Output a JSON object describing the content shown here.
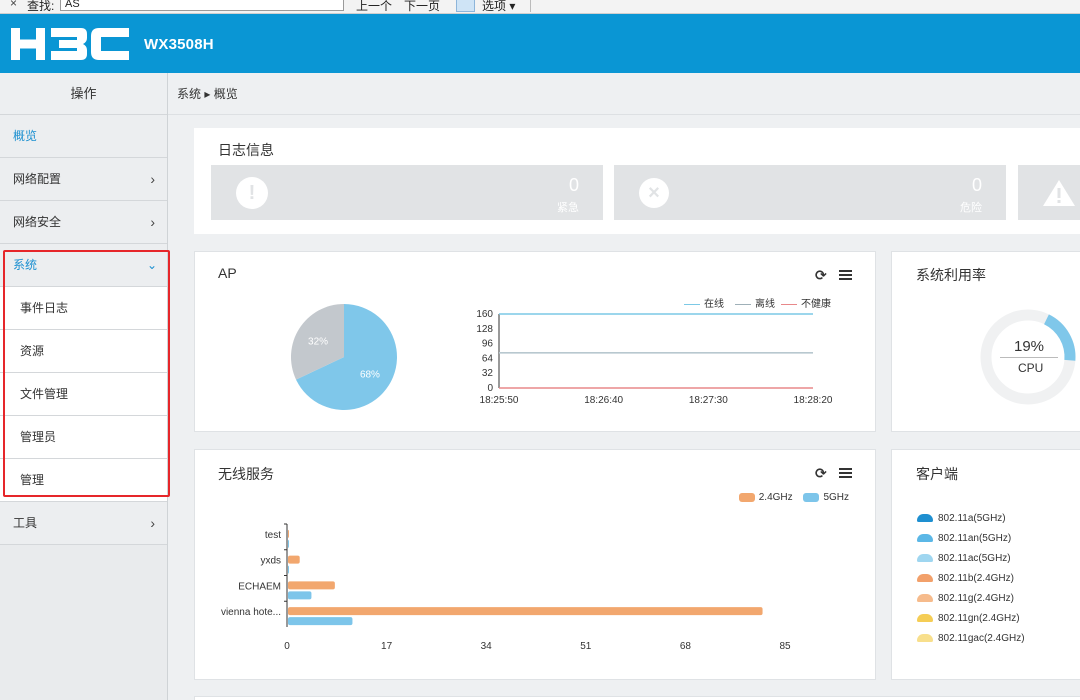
{
  "findbar": {
    "close": "×",
    "label": "查找:",
    "value": "AS",
    "prev": "上一个",
    "next": "下一页",
    "options": "选项 ▾"
  },
  "header": {
    "brand": "H3C",
    "model": "WX3508H",
    "color": "#0a96d4"
  },
  "sidebar": {
    "title": "操作",
    "items": [
      {
        "label": "概览",
        "active": true
      },
      {
        "label": "网络配置",
        "chevron": "›"
      },
      {
        "label": "网络安全",
        "chevron": "›"
      }
    ],
    "system": {
      "label": "系统",
      "chevron": "⌄",
      "children": [
        "事件日志",
        "资源",
        "文件管理",
        "管理员",
        "管理"
      ]
    },
    "tools": {
      "label": "工具",
      "chevron": "›"
    }
  },
  "breadcrumb": "系统 ▸ 概览",
  "log": {
    "title": "日志信息",
    "cards": [
      {
        "icon": "!",
        "icon_name": "exclamation-icon",
        "count": "0",
        "label": "紧急"
      },
      {
        "icon": "×",
        "icon_name": "cross-icon",
        "count": "0",
        "label": "危险"
      },
      {
        "icon": "!",
        "icon_name": "warning-triangle-icon",
        "count": "",
        "label": ""
      }
    ]
  },
  "ap": {
    "title": "AP",
    "legend": [
      {
        "name": "在线",
        "color": "#7cc9e6"
      },
      {
        "name": "离线",
        "color": "#9fb0b8"
      },
      {
        "name": "不健康",
        "color": "#e8888a"
      }
    ]
  },
  "util": {
    "title": "系统利用率",
    "value": "19%",
    "label": "CPU",
    "percent": 19,
    "color": "#7fc7ea",
    "track": "#f0f1f2"
  },
  "wireless": {
    "title": "无线服务",
    "legend": [
      {
        "name": "2.4GHz",
        "color": "#f2a76e"
      },
      {
        "name": "5GHz",
        "color": "#7dc5ea"
      }
    ]
  },
  "clients": {
    "title": "客户端",
    "items": [
      {
        "label": "802.11a(5GHz)",
        "color": "#1e8fd0"
      },
      {
        "label": "802.11an(5GHz)",
        "color": "#5bb7e6"
      },
      {
        "label": "802.11ac(5GHz)",
        "color": "#9fd6f0"
      },
      {
        "label": "802.11b(2.4GHz)",
        "color": "#f2a06a"
      },
      {
        "label": "802.11g(2.4GHz)",
        "color": "#f6bb8c"
      },
      {
        "label": "802.11gn(2.4GHz)",
        "color": "#f5cd55"
      },
      {
        "label": "802.11gac(2.4GHz)",
        "color": "#f8df8c"
      }
    ]
  },
  "chart_data": [
    {
      "type": "pie",
      "categories": [
        "在线",
        "离线"
      ],
      "values": [
        68,
        32
      ],
      "labels": [
        "68%",
        "32%"
      ],
      "colors": [
        "#7fc7ea",
        "#c3c8cd"
      ]
    },
    {
      "type": "line",
      "x": [
        "18:25:50",
        "18:26:40",
        "18:27:30",
        "18:28:20"
      ],
      "yticks": [
        0,
        32,
        64,
        96,
        128,
        160
      ],
      "ylim": [
        0,
        160
      ],
      "series": [
        {
          "name": "在线",
          "values": [
            160,
            160,
            160,
            160
          ],
          "color": "#7cc9e6"
        },
        {
          "name": "离线",
          "values": [
            76,
            76,
            76,
            76
          ],
          "color": "#b8c8cf"
        },
        {
          "name": "不健康",
          "values": [
            0,
            0,
            0,
            0
          ],
          "color": "#e8888a"
        }
      ]
    },
    {
      "type": "bar",
      "orientation": "horizontal",
      "categories": [
        "test",
        "yxds",
        "ECHAEM",
        "vienna hote..."
      ],
      "xticks": [
        0,
        17,
        34,
        51,
        68,
        85
      ],
      "xlim": [
        0,
        85
      ],
      "series": [
        {
          "name": "2.4GHz",
          "values": [
            0,
            2,
            8,
            81
          ],
          "color": "#f2a76e"
        },
        {
          "name": "5GHz",
          "values": [
            0,
            0,
            4,
            11
          ],
          "color": "#7dc5ea"
        }
      ]
    }
  ]
}
